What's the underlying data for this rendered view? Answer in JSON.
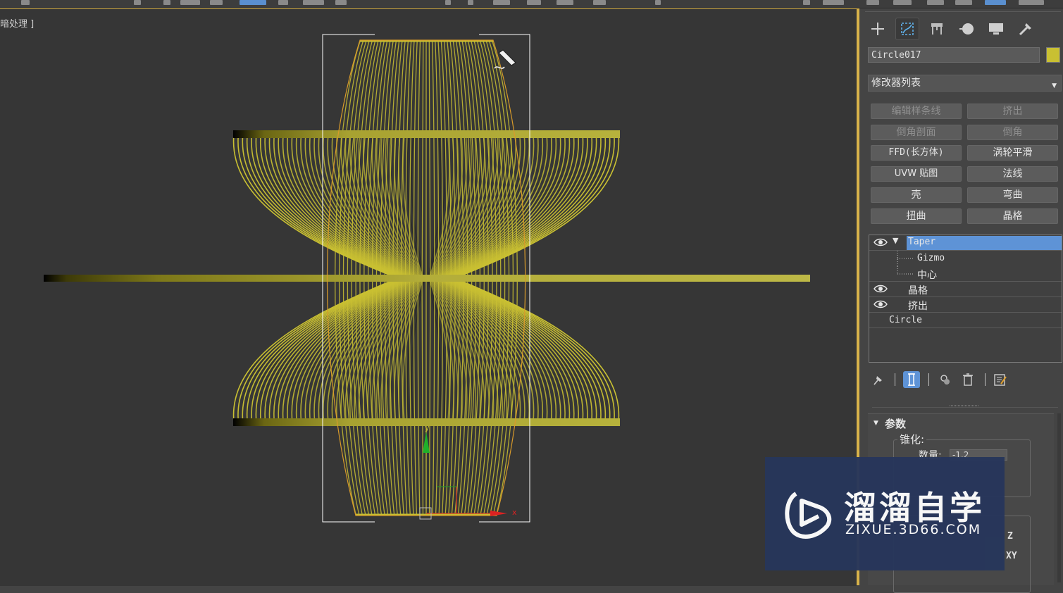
{
  "viewport": {
    "label": "暗处理 ]",
    "axis_y_label": "y",
    "axis_x_label": "x",
    "wire_color": "#c9c032",
    "bbox_color": "#ffffff"
  },
  "panel": {
    "tabs": [
      "create-icon",
      "modify-icon",
      "hierarchy-icon",
      "motion-icon",
      "display-icon",
      "utilities-icon"
    ],
    "object_name": "Circle017",
    "object_color": "#c9c032",
    "modifier_list": "修改器列表",
    "modifier_buttons": [
      "编辑样条线",
      "挤出",
      "倒角剖面",
      "倒角",
      "FFD(长方体)",
      "涡轮平滑",
      "UVW 贴图",
      "法线",
      "壳",
      "弯曲",
      "扭曲",
      "晶格"
    ],
    "stack": {
      "taper": "Taper",
      "gizmo": "Gizmo",
      "center": "中心",
      "lattice": "晶格",
      "extrude": "挤出",
      "circle": "Circle"
    },
    "rollout_title": "参数",
    "taper_group": "锥化:",
    "amount_label": "数量:",
    "amount_value": "-1.2",
    "axis_z": "Z",
    "axis_xy": "XY"
  },
  "watermark": {
    "title": "溜溜自学",
    "subtitle": "ZIXUE.3D66.COM"
  }
}
